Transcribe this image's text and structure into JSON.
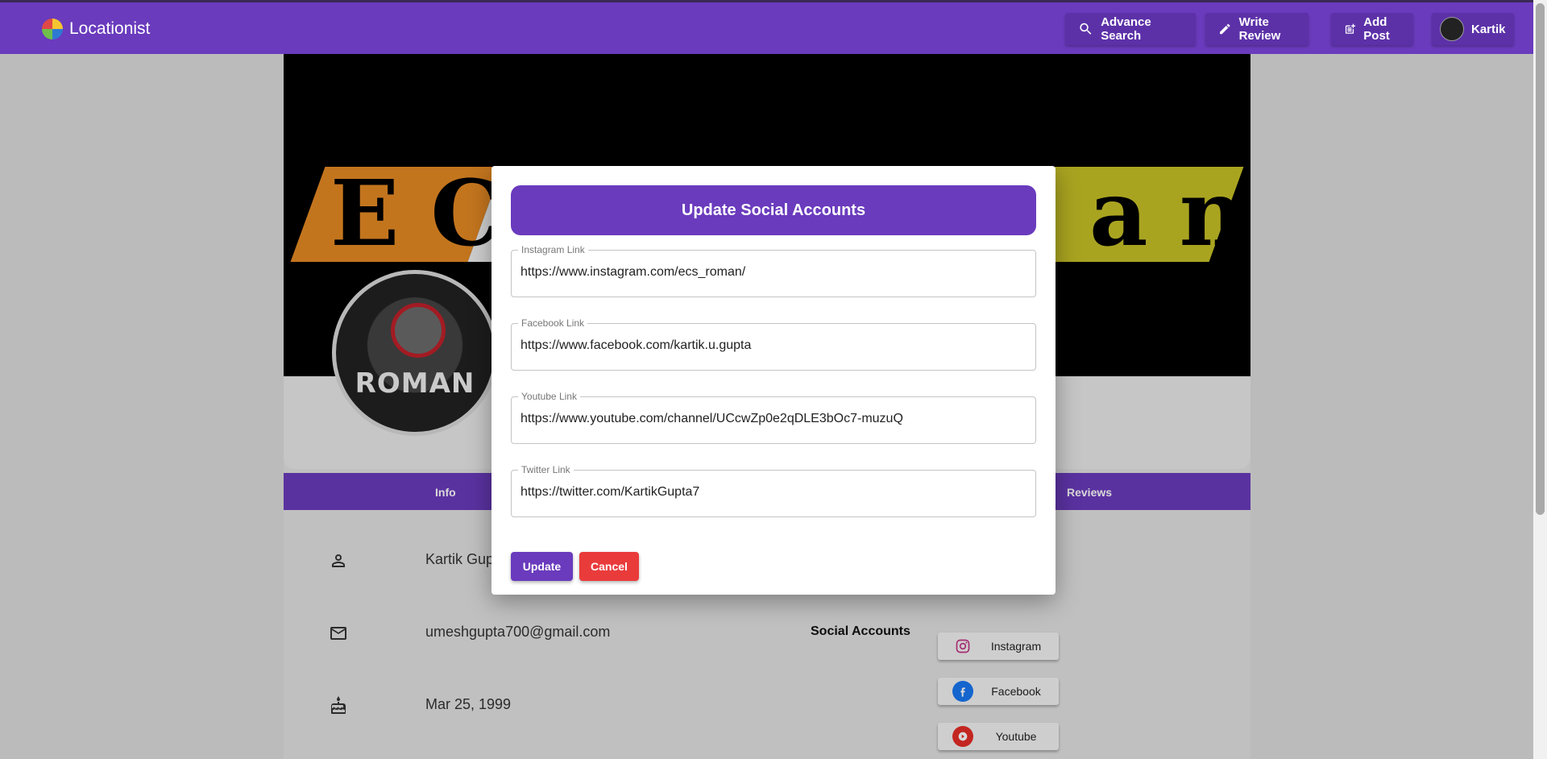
{
  "appbar": {
    "brand": "Locationist",
    "nav": {
      "advance_search": "Advance Search",
      "write_review": "Write Review",
      "add_post": "Add Post",
      "user": "Kartik"
    }
  },
  "cover": {
    "left_text": "E C",
    "right_text": "a n"
  },
  "avatar": {
    "word": "ROMAN"
  },
  "tabs": {
    "info": "Info",
    "reviews": "Reviews"
  },
  "info": {
    "name": "Kartik Gupta",
    "email": "umeshgupta700@gmail.com",
    "dob": "Mar 25, 1999"
  },
  "social": {
    "title": "Social Accounts",
    "instagram": "Instagram",
    "facebook": "Facebook",
    "youtube": "Youtube"
  },
  "dialog": {
    "title": "Update Social Accounts",
    "instagram": {
      "label": "Instagram Link",
      "value": "https://www.instagram.com/ecs_roman/"
    },
    "facebook": {
      "label": "Facebook Link",
      "value": "https://www.facebook.com/kartik.u.gupta"
    },
    "youtube": {
      "label": "Youtube Link",
      "value": "https://www.youtube.com/channel/UCcwZp0e2qDLE3bOc7-muzuQ"
    },
    "twitter": {
      "label": "Twitter Link",
      "value": "https://twitter.com/KartikGupta7"
    },
    "update_label": "Update",
    "cancel_label": "Cancel"
  },
  "colors": {
    "primary": "#6a3bbd",
    "danger": "#ea3b3b",
    "instagram": "#c13584",
    "facebook": "#1877f2",
    "youtube": "#e52d27"
  }
}
